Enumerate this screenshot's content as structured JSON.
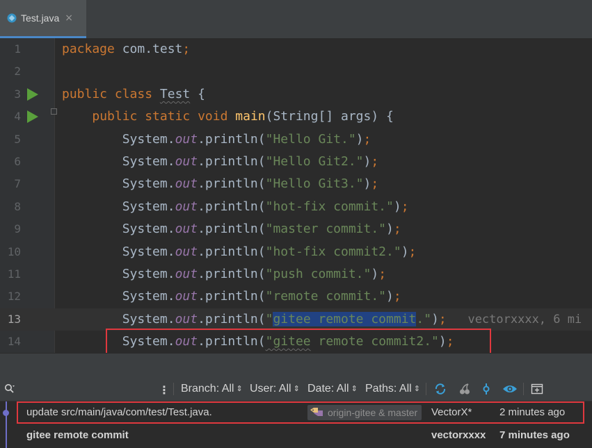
{
  "tab": {
    "label": "Test.java",
    "close": "×"
  },
  "lines": [
    {
      "no": "1",
      "parts": [
        [
          "kw",
          "package "
        ],
        [
          "plain",
          "com.test"
        ],
        [
          "kw",
          ";"
        ]
      ]
    },
    {
      "no": "2",
      "parts": []
    },
    {
      "no": "3",
      "run": true,
      "parts": [
        [
          "kw",
          "public class "
        ],
        [
          "squig",
          "Test"
        ],
        [
          "plain",
          " {"
        ]
      ]
    },
    {
      "no": "4",
      "run": true,
      "fold": true,
      "parts": [
        [
          "plain",
          "    "
        ],
        [
          "kw",
          "public static void "
        ],
        [
          "fn",
          "main"
        ],
        [
          "plain",
          "(String[] args) {"
        ]
      ]
    },
    {
      "no": "5",
      "parts": [
        [
          "plain",
          "        System."
        ],
        [
          "fld",
          "out"
        ],
        [
          "plain",
          ".println("
        ],
        [
          "str",
          "\"Hello Git.\""
        ],
        [
          "plain",
          ")"
        ],
        [
          "kw",
          ";"
        ]
      ]
    },
    {
      "no": "6",
      "parts": [
        [
          "plain",
          "        System."
        ],
        [
          "fld",
          "out"
        ],
        [
          "plain",
          ".println("
        ],
        [
          "str",
          "\"Hello Git2.\""
        ],
        [
          "plain",
          ")"
        ],
        [
          "kw",
          ";"
        ]
      ]
    },
    {
      "no": "7",
      "parts": [
        [
          "plain",
          "        System."
        ],
        [
          "fld",
          "out"
        ],
        [
          "plain",
          ".println("
        ],
        [
          "str",
          "\"Hello Git3.\""
        ],
        [
          "plain",
          ")"
        ],
        [
          "kw",
          ";"
        ]
      ]
    },
    {
      "no": "8",
      "parts": [
        [
          "plain",
          "        System."
        ],
        [
          "fld",
          "out"
        ],
        [
          "plain",
          ".println("
        ],
        [
          "str",
          "\"hot-fix commit.\""
        ],
        [
          "plain",
          ")"
        ],
        [
          "kw",
          ";"
        ]
      ]
    },
    {
      "no": "9",
      "parts": [
        [
          "plain",
          "        System."
        ],
        [
          "fld",
          "out"
        ],
        [
          "plain",
          ".println("
        ],
        [
          "str",
          "\"master commit.\""
        ],
        [
          "plain",
          ")"
        ],
        [
          "kw",
          ";"
        ]
      ]
    },
    {
      "no": "10",
      "parts": [
        [
          "plain",
          "        System."
        ],
        [
          "fld",
          "out"
        ],
        [
          "plain",
          ".println("
        ],
        [
          "str",
          "\"hot-fix commit2.\""
        ],
        [
          "plain",
          ")"
        ],
        [
          "kw",
          ";"
        ]
      ]
    },
    {
      "no": "11",
      "parts": [
        [
          "plain",
          "        System."
        ],
        [
          "fld",
          "out"
        ],
        [
          "plain",
          ".println("
        ],
        [
          "str",
          "\"push commit.\""
        ],
        [
          "plain",
          ")"
        ],
        [
          "kw",
          ";"
        ]
      ]
    },
    {
      "no": "12",
      "parts": [
        [
          "plain",
          "        System."
        ],
        [
          "fld",
          "out"
        ],
        [
          "plain",
          ".println("
        ],
        [
          "str",
          "\"remote commit.\""
        ],
        [
          "plain",
          ")"
        ],
        [
          "kw",
          ";"
        ]
      ]
    },
    {
      "no": "13",
      "current": true,
      "parts": [
        [
          "plain",
          "        System."
        ],
        [
          "fld",
          "out"
        ],
        [
          "plain",
          ".println("
        ],
        [
          "str",
          "\""
        ],
        [
          "strsel",
          "gitee remote commit"
        ],
        [
          "str",
          ".\""
        ],
        [
          "plain",
          ")"
        ],
        [
          "kw",
          ";"
        ],
        [
          "blame",
          "   vectorxxxx, 6 mi"
        ]
      ]
    },
    {
      "no": "14",
      "parts": [
        [
          "plain",
          "        System."
        ],
        [
          "fld",
          "out"
        ],
        [
          "plain",
          ".println("
        ],
        [
          "strsq",
          "\"gitee"
        ],
        [
          "str",
          " remote commit2.\""
        ],
        [
          "plain",
          ")"
        ],
        [
          "kw",
          ";"
        ]
      ]
    }
  ],
  "toolbar": {
    "more": "⋮",
    "branch": "Branch: All",
    "user": "User: All",
    "date": "Date: All",
    "paths": "Paths: All"
  },
  "commits": [
    {
      "message": "update src/main/java/com/test/Test.java.",
      "branches": "origin-gitee & master",
      "author": "VectorX*",
      "time": "2 minutes ago"
    },
    {
      "message": "gitee remote commit",
      "author": "vectorxxxx",
      "time": "7 minutes ago"
    }
  ],
  "colors": {
    "keyword": "#cc7832",
    "string": "#6a8759",
    "field": "#9876aa",
    "function": "#ffc66d",
    "highlight_box": "#e0383e",
    "graph": "#6f6fc9"
  }
}
